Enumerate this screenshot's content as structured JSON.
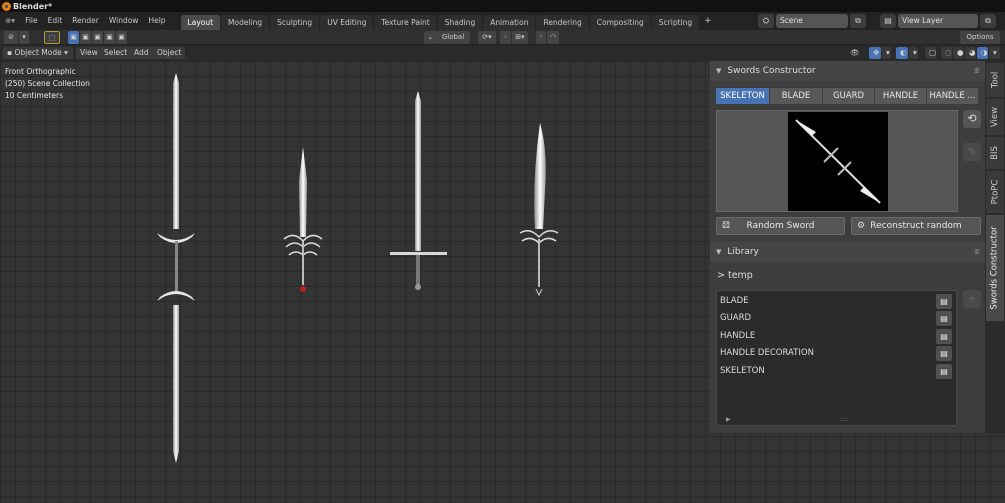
{
  "window": {
    "title": "Blender*"
  },
  "menu": [
    "File",
    "Edit",
    "Render",
    "Window",
    "Help"
  ],
  "workspaces": [
    "Layout",
    "Modeling",
    "Sculpting",
    "UV Editing",
    "Texture Paint",
    "Shading",
    "Animation",
    "Rendering",
    "Compositing",
    "Scripting"
  ],
  "active_workspace": "Layout",
  "scene": {
    "label": "Scene",
    "view_layer": "View Layer"
  },
  "tool_header": {
    "transform_orientation": "Global",
    "options_label": "Options"
  },
  "viewport_header": {
    "mode": "Object Mode",
    "menus": [
      "View",
      "Select",
      "Add",
      "Object"
    ]
  },
  "viewport_overlay": {
    "view_name": "Front Orthographic",
    "collection": "(250) Scene Collection",
    "scale": "10 Centimeters"
  },
  "swords_panel": {
    "title": "Swords Constructor",
    "tabs": [
      "SKELETON",
      "BLADE",
      "GUARD",
      "HANDLE",
      "HANDLE ..."
    ],
    "active_tab": "SKELETON",
    "random_button": "Random Sword",
    "reconstruct_button": "Reconstruct random"
  },
  "library_panel": {
    "title": "Library",
    "path": "> temp",
    "items": [
      "BLADE",
      "GUARD",
      "HANDLE",
      "HANDLE DECORATION",
      "SKELETON"
    ]
  },
  "side_tabs": [
    "Tool",
    "View",
    "BIS",
    "PtoPC",
    "Swords Constructor"
  ],
  "active_side_tab": "Swords Constructor",
  "colors": {
    "accent": "#4772b3",
    "logo": "#e87d0d",
    "panel": "#3d3d3d"
  }
}
